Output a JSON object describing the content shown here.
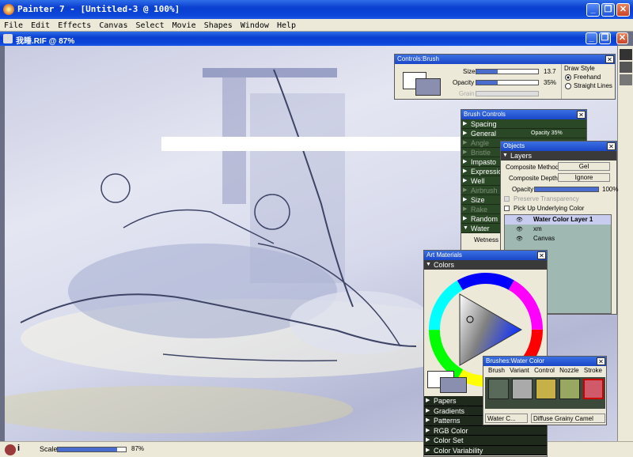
{
  "app": {
    "title": "Painter 7 - [Untitled-3 @ 100%]"
  },
  "menu": [
    "File",
    "Edit",
    "Effects",
    "Canvas",
    "Select",
    "Movie",
    "Shapes",
    "Window",
    "Help"
  ],
  "document": {
    "title": "我睡.RIF @ 87%"
  },
  "controls_brush": {
    "title": "Controls:Brush",
    "size_label": "Size",
    "size_value": "13.7",
    "size_fill": 0.35,
    "opacity_label": "Opacity",
    "opacity_value": "35%",
    "opacity_fill": 0.35,
    "grain_label": "Grain",
    "draw_style_label": "Draw Style",
    "freehand": "Freehand",
    "straight": "Straight Lines",
    "selected": "Freehand"
  },
  "brush_controls": {
    "title": "Brush Controls",
    "items": [
      {
        "label": "Spacing",
        "enabled": true
      },
      {
        "label": "General",
        "enabled": true,
        "extra": "Opacity 35%"
      },
      {
        "label": "Angle",
        "enabled": false
      },
      {
        "label": "Bristle",
        "enabled": false
      },
      {
        "label": "Impasto",
        "enabled": true
      },
      {
        "label": "Expression",
        "enabled": true
      },
      {
        "label": "Well",
        "enabled": true
      },
      {
        "label": "Airbrush",
        "enabled": false
      },
      {
        "label": "Size",
        "enabled": true
      },
      {
        "label": "Rake",
        "enabled": false
      },
      {
        "label": "Random",
        "enabled": true
      },
      {
        "label": "Water",
        "enabled": true,
        "open": true
      }
    ],
    "wetness_label": "Wetness"
  },
  "objects": {
    "title": "Objects",
    "section": "Layers",
    "composite_method_label": "Composite Method",
    "composite_method": "Gel",
    "composite_depth_label": "Composite Depth",
    "composite_depth": "Ignore",
    "opacity_label": "Opacity",
    "opacity_value": "100%",
    "opacity_fill": 1.0,
    "preserve": "Preserve Transparency",
    "pickup": "Pick Up Underlying Color",
    "layers": [
      "Water Color Layer 1",
      "xm",
      "Canvas"
    ]
  },
  "art_materials": {
    "title": "Art Materials",
    "section": "Colors",
    "items": [
      "Papers",
      "Gradients",
      "Patterns",
      "RGB Color",
      "Color Set",
      "Color Variability"
    ]
  },
  "brushes": {
    "title": "Brushes:Water Color",
    "menu": [
      "Brush",
      "Variant",
      "Control",
      "Nozzle",
      "Stroke"
    ],
    "category": "Water C...",
    "variant": "Diffuse Grainy Camel"
  },
  "status": {
    "scale_label": "Scale",
    "scale_value": "87%",
    "scale_fill": 0.87
  },
  "colors": {
    "accent_blue": "#0a3fd0",
    "primary_swatch": "#8a8fb0",
    "brush_panel_green": "#2b4826"
  }
}
